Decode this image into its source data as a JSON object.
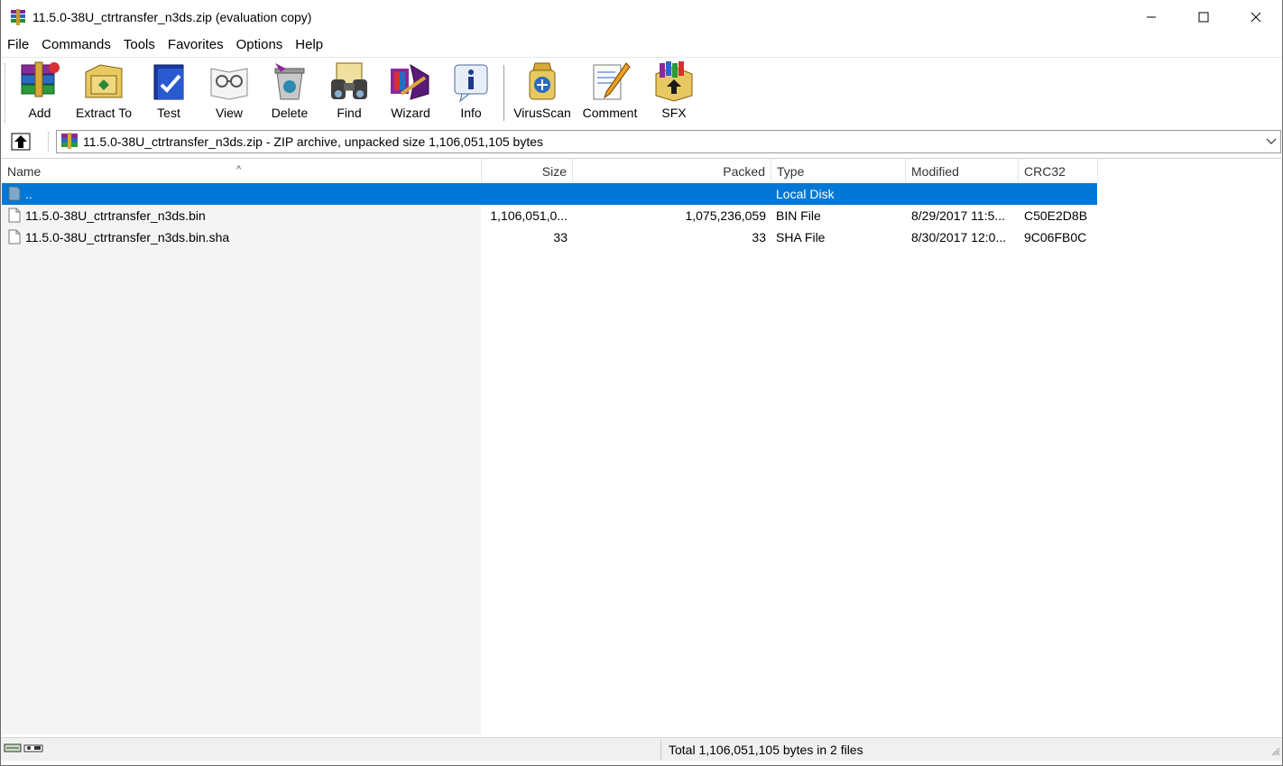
{
  "window": {
    "title": "11.5.0-38U_ctrtransfer_n3ds.zip (evaluation copy)"
  },
  "menu": [
    "File",
    "Commands",
    "Tools",
    "Favorites",
    "Options",
    "Help"
  ],
  "toolbar": {
    "buttons": [
      {
        "label": "Add",
        "icon": "add-archive-icon"
      },
      {
        "label": "Extract To",
        "icon": "extract-to-icon"
      },
      {
        "label": "Test",
        "icon": "test-icon"
      },
      {
        "label": "View",
        "icon": "view-icon"
      },
      {
        "label": "Delete",
        "icon": "delete-icon"
      },
      {
        "label": "Find",
        "icon": "find-binoculars-icon"
      },
      {
        "label": "Wizard",
        "icon": "wizard-icon"
      },
      {
        "label": "Info",
        "icon": "info-icon"
      },
      {
        "label": "VirusScan",
        "icon": "virusscan-icon"
      },
      {
        "label": "Comment",
        "icon": "comment-icon"
      },
      {
        "label": "SFX",
        "icon": "sfx-icon"
      }
    ]
  },
  "address": {
    "text": "11.5.0-38U_ctrtransfer_n3ds.zip - ZIP archive, unpacked size 1,106,051,105 bytes"
  },
  "columns": [
    "Name",
    "Size",
    "Packed",
    "Type",
    "Modified",
    "CRC32"
  ],
  "rows": [
    {
      "name": "..",
      "size": "",
      "packed": "",
      "type": "Local Disk",
      "modified": "",
      "crc": "",
      "selected": true
    },
    {
      "name": "11.5.0-38U_ctrtransfer_n3ds.bin",
      "size": "1,106,051,0...",
      "packed": "1,075,236,059",
      "type": "BIN File",
      "modified": "8/29/2017 11:5...",
      "crc": "C50E2D8B",
      "selected": false
    },
    {
      "name": "11.5.0-38U_ctrtransfer_n3ds.bin.sha",
      "size": "33",
      "packed": "33",
      "type": "SHA File",
      "modified": "8/30/2017 12:0...",
      "crc": "9C06FB0C",
      "selected": false
    }
  ],
  "status": {
    "text": "Total 1,106,051,105 bytes in 2 files"
  },
  "colors": {
    "selection": "#0078d7",
    "name_column_bg": "#f4f4f4"
  }
}
